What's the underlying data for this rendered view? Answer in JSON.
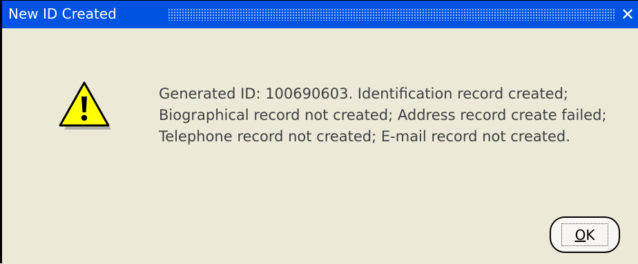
{
  "window": {
    "title": "New ID Created",
    "close_glyph": "✕"
  },
  "dialog": {
    "icon": "warning-icon",
    "message": "Generated ID: 100690603.  Identification record created; Biographical record not created; Address record create failed; Telephone record not created; E-mail record not created."
  },
  "buttons": {
    "ok_mnemonic": "O",
    "ok_rest": "K"
  },
  "colors": {
    "titlebar": "#0054e3",
    "dialog_bg": "#ece9d8",
    "warning_fill": "#ffff00"
  }
}
